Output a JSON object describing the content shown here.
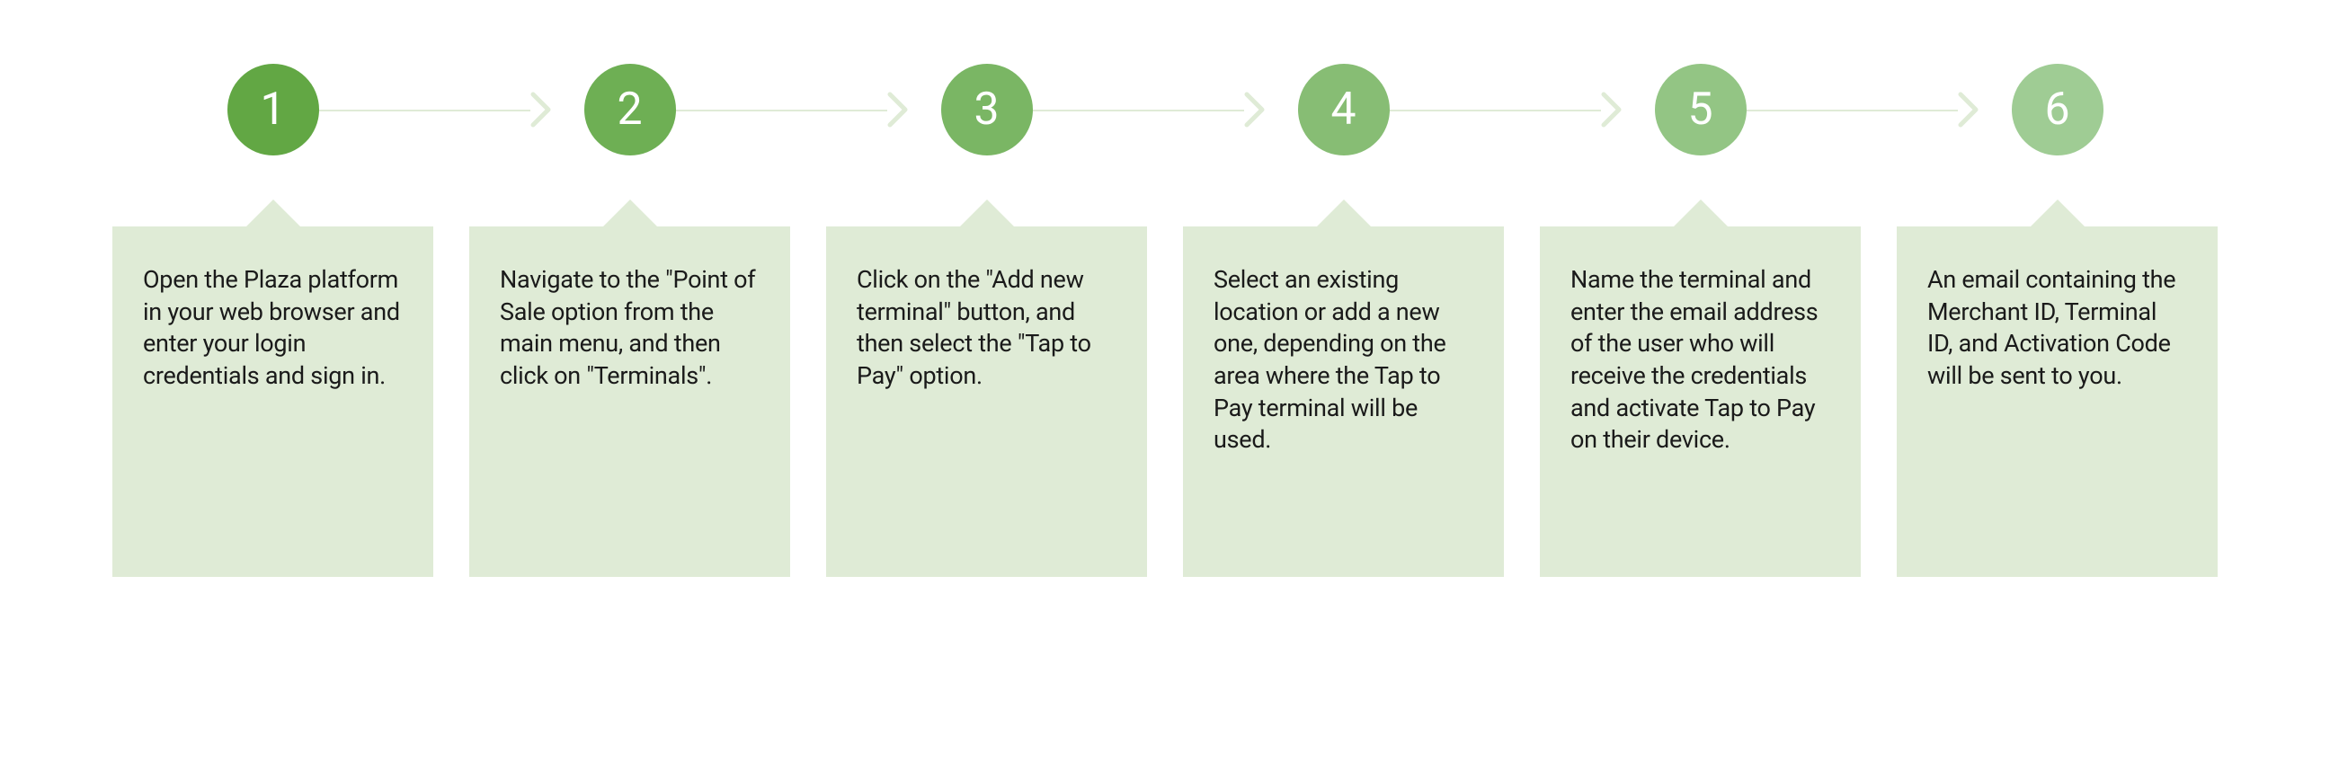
{
  "colors": {
    "card_bg": "#dfebd6",
    "connector": "#dfebd6",
    "chevron": "#dfebd6",
    "badge_fills": [
      "#62a744",
      "#6eaf54",
      "#7ab664",
      "#87bd74",
      "#93c584",
      "#9fcc94"
    ]
  },
  "steps": [
    {
      "number": "1",
      "text": "Open the Plaza platform in your web browser and enter your login credentials and sign in."
    },
    {
      "number": "2",
      "text": "Navigate to the \"Point of Sale option from the main menu, and then click on \"Terminals\"."
    },
    {
      "number": "3",
      "text": "Click on the \"Add new terminal\" button, and then select the \"Tap to Pay\" option."
    },
    {
      "number": "4",
      "text": "Select an existing location or add a new one, depending on the area where the Tap to Pay terminal will be used."
    },
    {
      "number": "5",
      "text": "Name the terminal and enter the email address of the user who will receive the credentials and activate Tap to Pay on their device."
    },
    {
      "number": "6",
      "text": "An email containing the Merchant ID, Terminal ID, and Activation Code will be sent to you."
    }
  ]
}
